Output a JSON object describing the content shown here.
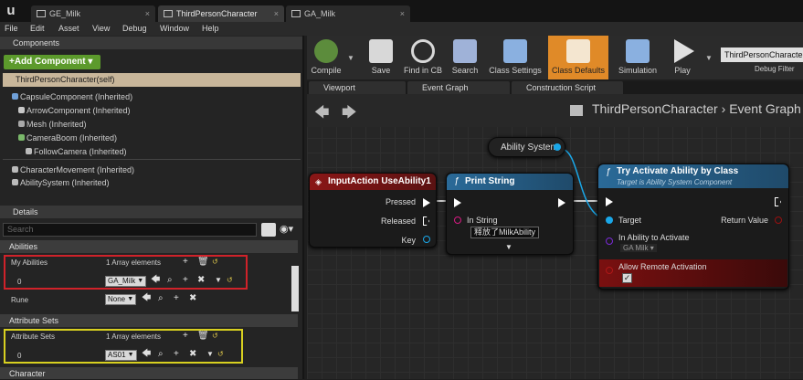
{
  "window": {
    "tabs": [
      {
        "label": "GE_Milk"
      },
      {
        "label": "ThirdPersonCharacter"
      },
      {
        "label": "GA_Milk"
      }
    ],
    "close_glyph": "×"
  },
  "menu": [
    "File",
    "Edit",
    "Asset",
    "View",
    "Debug",
    "Window",
    "Help"
  ],
  "components": {
    "title": "Components",
    "add_button": "+Add Component ▾",
    "self_item": "ThirdPersonCharacter(self)",
    "items": [
      "CapsuleComponent (Inherited)",
      "ArrowComponent (Inherited)",
      "Mesh (Inherited)",
      "CameraBoom (Inherited)",
      "FollowCamera (Inherited)",
      "CharacterMovement (Inherited)",
      "AbilitySystem (Inherited)"
    ]
  },
  "details": {
    "title": "Details",
    "search_placeholder": "Search",
    "sections": {
      "abilities": "Abilities",
      "attribute_sets": "Attribute Sets",
      "character": "Character"
    },
    "my_abilities": {
      "label": "My Abilities",
      "count": "1 Array elements",
      "index": "0",
      "value": "GA_Milk"
    },
    "rune": {
      "label": "Rune",
      "value": "None"
    },
    "attribute_sets": {
      "label": "Attribute Sets",
      "count": "1 Array elements",
      "index": "0",
      "value": "AS01"
    }
  },
  "toolbar": {
    "buttons": [
      "Compile",
      "Save",
      "Find in CB",
      "Search",
      "Class Settings",
      "Class Defaults",
      "Simulation",
      "Play"
    ],
    "debug_object": "ThirdPersonCharacter",
    "debug_filter": "Debug Filter"
  },
  "editor_tabs": [
    "Viewport",
    "Event Graph",
    "Construction Script"
  ],
  "graph": {
    "breadcrumb_class": "ThirdPersonCharacter",
    "breadcrumb_sep": "›",
    "breadcrumb_graph": "Event Graph",
    "ability_system_node": "Ability System",
    "input_action": {
      "title": "InputAction UseAbility1",
      "pins": [
        "Pressed",
        "Released",
        "Key"
      ]
    },
    "print_string": {
      "title": "Print String",
      "in_string_label": "In String",
      "in_string_value": "释放了MilkAbility"
    },
    "try_activate": {
      "title": "Try Activate Ability by Class",
      "subtitle": "Target is Ability System Component",
      "target": "Target",
      "return_value": "Return Value",
      "in_ability": "In Ability to Activate",
      "in_ability_value": "GA Milk ▾",
      "allow_remote": "Allow Remote Activation"
    }
  },
  "colors": {
    "accent_orange": "#e08a28",
    "add_green": "#5c9a2c",
    "highlight_red": "#d0222a",
    "highlight_yellow": "#d8d020",
    "exec_white": "#ffffff",
    "object_pin_blue": "#1aa7e8"
  }
}
